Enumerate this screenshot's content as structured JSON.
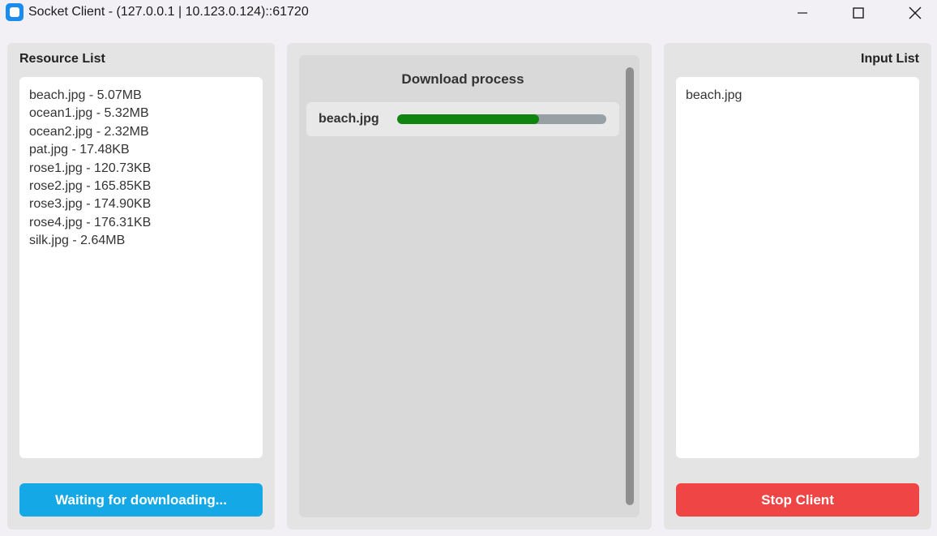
{
  "window": {
    "title": "Socket Client - (127.0.0.1 | 10.123.0.124)::61720"
  },
  "resource_list": {
    "title": "Resource List",
    "items": [
      "beach.jpg - 5.07MB",
      "ocean1.jpg - 5.32MB",
      "ocean2.jpg - 2.32MB",
      "pat.jpg - 17.48KB",
      "rose1.jpg - 120.73KB",
      "rose2.jpg - 165.85KB",
      "rose3.jpg - 174.90KB",
      "rose4.jpg - 176.31KB",
      "silk.jpg - 2.64MB"
    ],
    "button_label": "Waiting for downloading..."
  },
  "download": {
    "title": "Download process",
    "items": [
      {
        "name": "beach.jpg",
        "progress": 0.68
      }
    ]
  },
  "input_list": {
    "title": "Input List",
    "items": [
      "beach.jpg"
    ],
    "button_label": "Stop Client"
  },
  "colors": {
    "progress_fill": "#0f840f",
    "progress_track": "#98a0a6",
    "wait_button": "#14a8e6",
    "stop_button": "#f04545",
    "app_icon": "#1a8cf0"
  },
  "icons": {
    "app": "app-icon",
    "minimize": "minimize-icon",
    "maximize": "maximize-icon",
    "close": "close-icon"
  }
}
